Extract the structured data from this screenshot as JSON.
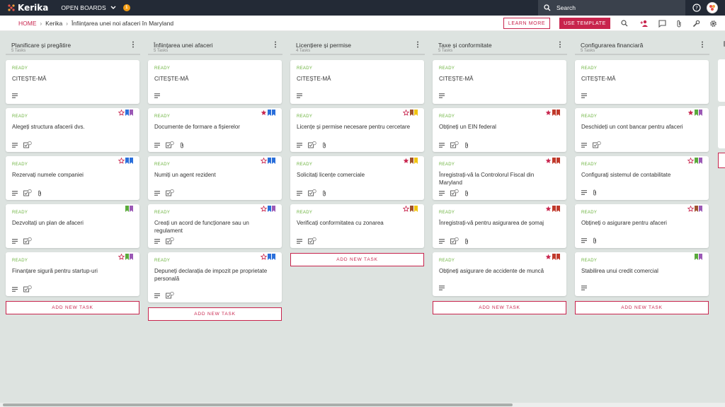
{
  "app": {
    "name": "Kerika",
    "open_boards_label": "OPEN BOARDS",
    "board_badge": "1"
  },
  "search": {
    "label": "Search"
  },
  "breadcrumb": {
    "home": "HOME",
    "org": "Kerika",
    "board": "Înființarea unei noi afaceri în Maryland"
  },
  "toolbar": {
    "learn_more": "LEARN MORE",
    "use_template": "USE TEMPLATE"
  },
  "colors": {
    "accent": "#c8244d",
    "ready": "#6cb33e",
    "topbar": "#232a36"
  },
  "add_task_label": "ADD NEW TASK",
  "columns": [
    {
      "title": "Planificare și pregătire",
      "count": "5 Tasks",
      "cards": [
        {
          "status": "READY",
          "title": "CITEȘTE-MĂ",
          "flags": [],
          "meta": [
            "desc"
          ]
        },
        {
          "status": "READY",
          "title": "Alegeți structura afacerii dvs.",
          "flags": [
            "star-empty",
            "blue",
            "purple"
          ],
          "meta": [
            "desc",
            "check:3"
          ]
        },
        {
          "status": "READY",
          "title": "Rezervați numele companiei",
          "flags": [
            "star-empty",
            "blue",
            "blue"
          ],
          "meta": [
            "desc",
            "check:4",
            "attach"
          ]
        },
        {
          "status": "READY",
          "title": "Dezvoltați un plan de afaceri",
          "flags": [
            "green",
            "purple"
          ],
          "meta": [
            "desc",
            "check:4"
          ]
        },
        {
          "status": "READY",
          "title": "Finanțare sigură pentru startup-uri",
          "flags": [
            "star-empty",
            "green",
            "purple"
          ],
          "meta": [
            "desc",
            "check:2"
          ]
        }
      ]
    },
    {
      "title": "Înființarea unei afaceri",
      "count": "5 Tasks",
      "cards": [
        {
          "status": "READY",
          "title": "CITEȘTE-MĂ",
          "flags": [],
          "meta": [
            "desc"
          ]
        },
        {
          "status": "READY",
          "title": "Documente de formare a fișierelor",
          "flags": [
            "star-full",
            "blue",
            "blue"
          ],
          "meta": [
            "desc",
            "check:3",
            "attach"
          ]
        },
        {
          "status": "READY",
          "title": "Numiți un agent rezident",
          "flags": [
            "star-empty",
            "blue",
            "blue"
          ],
          "meta": [
            "desc",
            "check:2"
          ]
        },
        {
          "status": "READY",
          "title": "Creați un acord de funcționare sau un regulament",
          "flags": [
            "star-empty",
            "blue",
            "purple"
          ],
          "meta": [
            "desc",
            "check:2"
          ]
        },
        {
          "status": "READY",
          "title": "Depuneți declarația de impozit pe proprietate personală",
          "flags": [
            "star-empty",
            "blue",
            "blue"
          ],
          "meta": [
            "desc",
            "check:2"
          ]
        }
      ]
    },
    {
      "title": "Licențiere și permise",
      "count": "4 Tasks",
      "cards": [
        {
          "status": "READY",
          "title": "CITEȘTE-MĂ",
          "flags": [],
          "meta": [
            "desc"
          ]
        },
        {
          "status": "READY",
          "title": "Licențe și permise necesare pentru cercetare",
          "flags": [
            "star-empty",
            "brown",
            "yellow"
          ],
          "meta": [
            "desc",
            "check:3",
            "attach"
          ]
        },
        {
          "status": "READY",
          "title": "Solicitați licențe comerciale",
          "flags": [
            "star-full",
            "brown",
            "yellow"
          ],
          "meta": [
            "desc",
            "check:2",
            "attach"
          ]
        },
        {
          "status": "READY",
          "title": "Verificați conformitatea cu zonarea",
          "flags": [
            "star-empty",
            "brown",
            "yellow"
          ],
          "meta": [
            "desc",
            "check:2"
          ]
        }
      ]
    },
    {
      "title": "Taxe și conformitate",
      "count": "5 Tasks",
      "cards": [
        {
          "status": "READY",
          "title": "CITEȘTE-MĂ",
          "flags": [],
          "meta": [
            "desc"
          ]
        },
        {
          "status": "READY",
          "title": "Obțineți un EIN federal",
          "flags": [
            "star-full",
            "red",
            "red"
          ],
          "meta": [
            "desc",
            "check:3",
            "attach"
          ]
        },
        {
          "status": "READY",
          "title": "Înregistrați-vă la Controlorul Fiscal din Maryland",
          "flags": [
            "star-full",
            "red",
            "red"
          ],
          "meta": [
            "desc",
            "check:2",
            "attach"
          ]
        },
        {
          "status": "READY",
          "title": "Înregistrați-vă pentru asigurarea de șomaj",
          "flags": [
            "star-full",
            "red",
            "red"
          ],
          "meta": [
            "desc",
            "check:2",
            "attach"
          ]
        },
        {
          "status": "READY",
          "title": "Obțineți asigurare de accidente de muncă",
          "flags": [
            "star-full",
            "red",
            "red"
          ],
          "meta": [
            "desc"
          ]
        }
      ]
    },
    {
      "title": "Configurarea financiară",
      "count": "5 Tasks",
      "cards": [
        {
          "status": "READY",
          "title": "CITEȘTE-MĂ",
          "flags": [],
          "meta": [
            "desc"
          ]
        },
        {
          "status": "READY",
          "title": "Deschideți un cont bancar pentru afaceri",
          "flags": [
            "star-full",
            "green",
            "purple"
          ],
          "meta": [
            "desc",
            "check:2"
          ]
        },
        {
          "status": "READY",
          "title": "Configurați sistemul de contabilitate",
          "flags": [
            "star-empty",
            "green",
            "purple"
          ],
          "meta": [
            "desc",
            "attach"
          ]
        },
        {
          "status": "READY",
          "title": "Obțineți o asigurare pentru afaceri",
          "flags": [
            "star-empty",
            "brown",
            "purple"
          ],
          "meta": [
            "desc",
            "attach"
          ]
        },
        {
          "status": "READY",
          "title": "Stabilirea unui credit comercial",
          "flags": [
            "green",
            "purple"
          ],
          "meta": [
            "desc"
          ]
        }
      ]
    }
  ]
}
